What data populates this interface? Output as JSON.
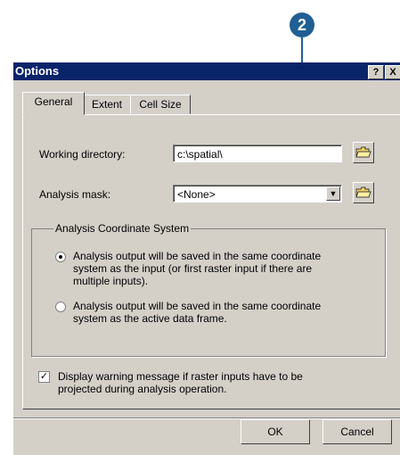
{
  "callout": {
    "number": "2"
  },
  "window": {
    "title": "Options",
    "help_glyph": "?",
    "close_glyph": "X"
  },
  "tabs": [
    {
      "label": "General",
      "active": true
    },
    {
      "label": "Extent",
      "active": false
    },
    {
      "label": "Cell Size",
      "active": false
    }
  ],
  "general": {
    "working_directory_label": "Working directory:",
    "working_directory_value": "c:\\spatial\\",
    "analysis_mask_label": "Analysis mask:",
    "analysis_mask_value": "<None>",
    "dropdown_arrow": "▼"
  },
  "coordinate_system": {
    "title": "Analysis Coordinate System",
    "options": [
      {
        "line1": "Analysis output will be saved in the same coordinate",
        "line2": "system as the input (or first raster input if there are",
        "line3": "multiple inputs).",
        "selected": true
      },
      {
        "line1": "Analysis output will be saved in the same coordinate",
        "line2": "system as the active data frame.",
        "selected": false
      }
    ]
  },
  "warning_option": {
    "checked": true,
    "check_glyph": "✓",
    "line1": "Display warning message if raster inputs have to be",
    "line2": "projected during analysis operation."
  },
  "buttons": {
    "ok": "OK",
    "cancel": "Cancel"
  },
  "icons": [
    "folder-open-icon",
    "folder-open-icon",
    "help-icon",
    "close-icon",
    "dropdown-arrow-icon"
  ],
  "colors": {
    "titlebar": "#0a246a",
    "dialog": "#d4d0c8",
    "callout": "#1f5f93"
  }
}
